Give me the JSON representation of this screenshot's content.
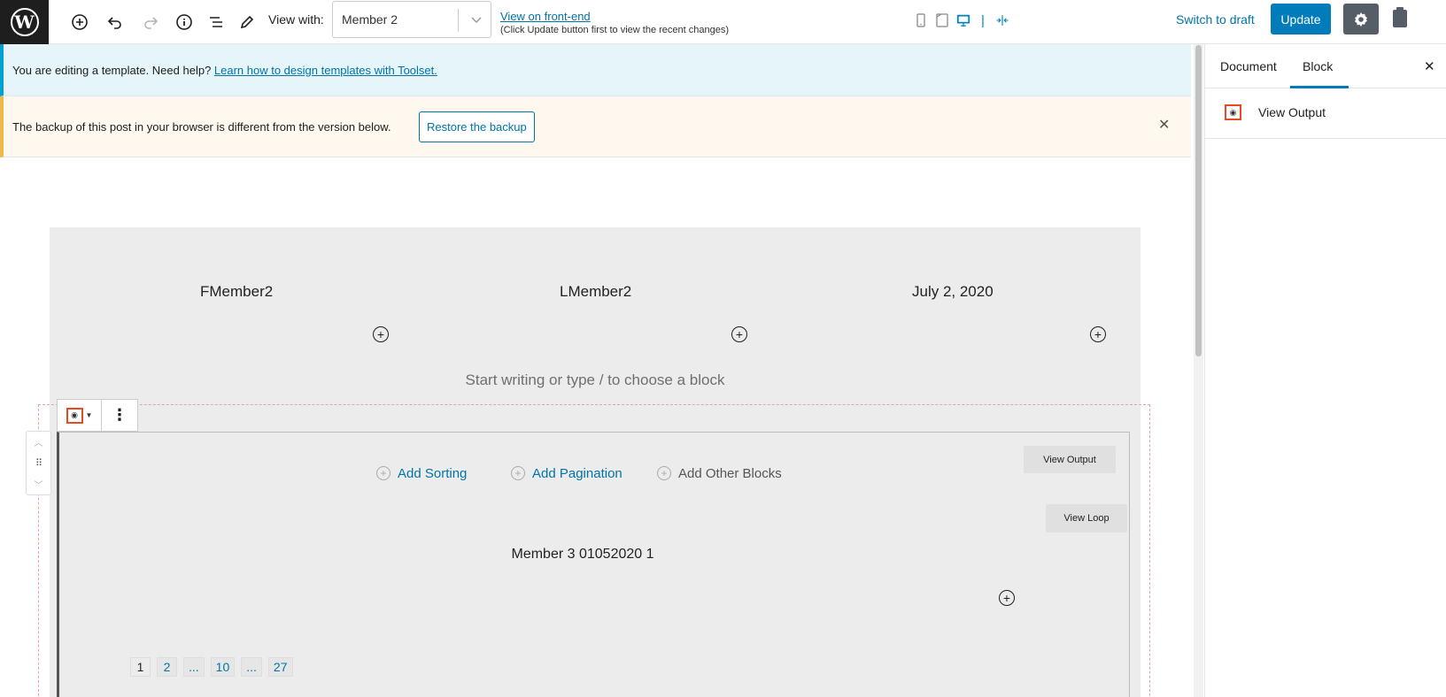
{
  "toolbar": {
    "logo": "W",
    "view_with_label": "View with:",
    "view_with_value": "Member 2",
    "frontend_link": "View on front-end",
    "frontend_note": "(Click Update button first to view the recent changes)",
    "switch_draft": "Switch to draft",
    "update": "Update",
    "icons": [
      "add-block-icon",
      "undo-icon",
      "redo-icon",
      "info-icon",
      "outline-icon",
      "edit-icon"
    ],
    "devices": [
      "mobile-icon",
      "tablet-icon",
      "desktop-icon",
      "full-width-icon"
    ]
  },
  "notices": {
    "info_text": "You are editing a template. Need help? ",
    "info_link": "Learn how to design templates with Toolset.",
    "backup_text": "The backup of this post in your browser is different from the version below.",
    "restore_button": "Restore the backup",
    "close": "✕"
  },
  "template": {
    "columns": [
      "FMember2",
      "LMember2",
      "July 2, 2020"
    ],
    "placeholder": "Start writing or type / to choose a block"
  },
  "view_block": {
    "add_sorting": "Add Sorting",
    "add_pagination": "Add Pagination",
    "add_other": "Add Other Blocks",
    "view_output": "View Output",
    "view_loop": "View Loop",
    "loop_item": "Member 3 01052020 1",
    "pages": [
      "1",
      "2",
      "...",
      "10",
      "...",
      "27"
    ],
    "current_page": "1"
  },
  "sidebar": {
    "tab_document": "Document",
    "tab_block": "Block",
    "active_tab": "Block",
    "close": "✕",
    "block_title": "View Output"
  },
  "colors": {
    "accent": "#007cba",
    "link": "#0073aa",
    "info_bg": "#e5f5fa",
    "warn_bg": "#fef8ee",
    "selection_border": "#e24c20"
  }
}
